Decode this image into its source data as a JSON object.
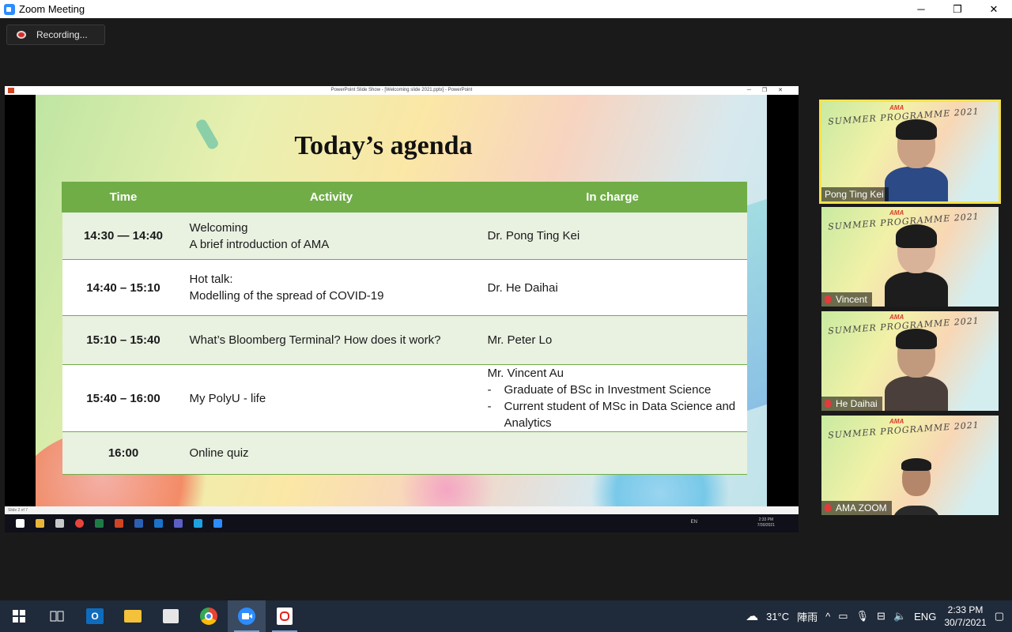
{
  "window": {
    "title": "Zoom Meeting",
    "minimize": "─",
    "restore": "❐",
    "close": "✕"
  },
  "recording": {
    "label": "Recording..."
  },
  "powerpoint": {
    "title": "PowerPoint Slide Show - [Welcoming slide 2021.pptx] - PowerPoint",
    "status": "Slide 2 of 7"
  },
  "slide": {
    "title": "Today’s agenda",
    "headers": [
      "Time",
      "Activity",
      "In charge"
    ],
    "rows": [
      {
        "time": "14:30 — 14:40",
        "activity": [
          "Welcoming",
          "A brief introduction of AMA"
        ],
        "in_charge": "Dr. Pong Ting Kei"
      },
      {
        "time": "14:40 – 15:10",
        "activity": [
          "Hot talk:",
          "Modelling of the spread of COVID-19"
        ],
        "in_charge": "Dr. He Daihai"
      },
      {
        "time": "15:10 – 15:40",
        "activity": [
          "What’s Bloomberg Terminal?  How does it work?"
        ],
        "in_charge": "Mr. Peter Lo"
      },
      {
        "time": "15:40 – 16:00",
        "activity": [
          "My PolyU - life"
        ],
        "in_charge": "Mr. Vincent Au",
        "in_charge_bullets": [
          "Graduate of BSc in Investment Science",
          "Current student of MSc in Data Science and Analytics"
        ]
      },
      {
        "time": "16:00",
        "activity": [
          "Online quiz"
        ],
        "in_charge": ""
      }
    ]
  },
  "inner_taskbar": {
    "lang": "EN",
    "time": "2:33 PM",
    "date": "7/30/2021"
  },
  "participants": [
    {
      "name": "Pong Ting Kei",
      "muted": false,
      "active": true,
      "banner": "SUMMER PROGRAMME 2021",
      "logo": "AMA"
    },
    {
      "name": "Vincent",
      "muted": true,
      "active": false,
      "banner": "SUMMER PROGRAMME 2021",
      "logo": "AMA"
    },
    {
      "name": "He Daihai",
      "muted": true,
      "active": false,
      "banner": "SUMMER PROGRAMME 2021",
      "logo": "AMA"
    },
    {
      "name": "AMA ZOOM",
      "muted": true,
      "active": false,
      "banner": "SUMMER PROGRAMME 2021",
      "logo": "AMA"
    }
  ],
  "taskbar": {
    "weather": "31°C",
    "weather_text": "陣雨",
    "lang": "ENG",
    "time": "2:33 PM",
    "date": "30/7/2021"
  }
}
